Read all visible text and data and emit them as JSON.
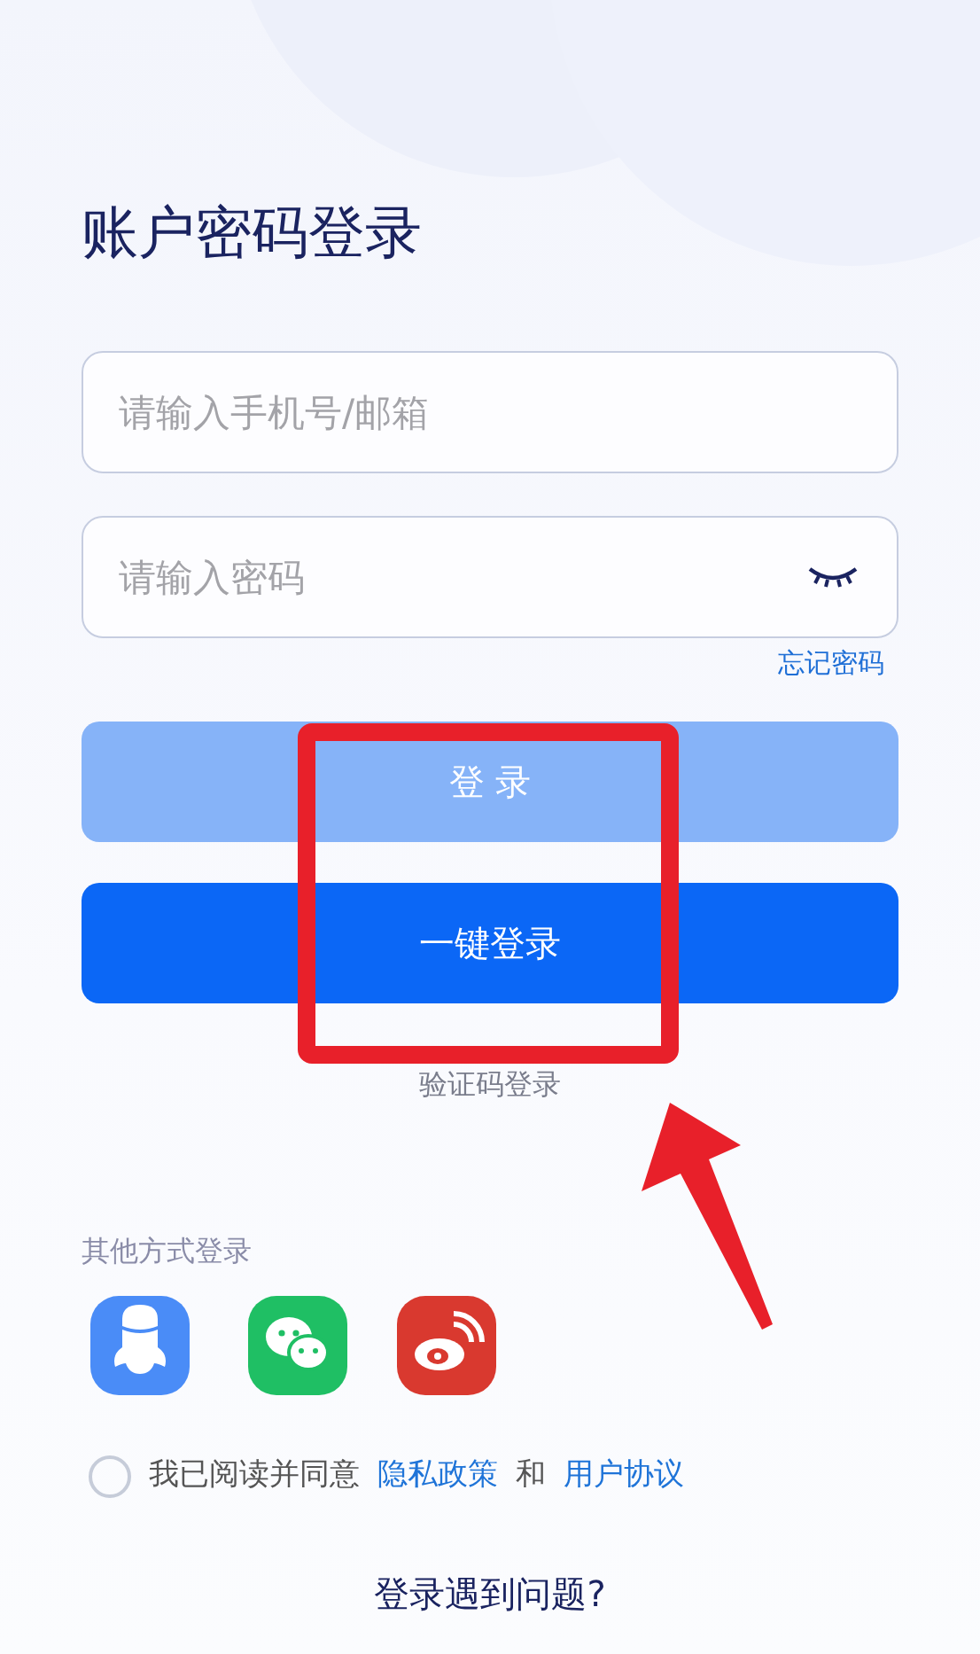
{
  "title": "账户密码登录",
  "fields": [
    {
      "kind": "text",
      "placeholder": "请输入手机号/邮箱"
    },
    {
      "kind": "password",
      "placeholder": "请输入密码",
      "revealed": false
    }
  ],
  "forgot_link": "忘记密码",
  "buttons": [
    {
      "label": "登 录",
      "disabled": true
    },
    {
      "label": "一键登录",
      "disabled": false
    }
  ],
  "alt_link": "验证码登录",
  "other_methods": {
    "label": "其他方式登录",
    "apps": [
      {
        "kind": "qq",
        "color": "#4a8cf7"
      },
      {
        "kind": "chat",
        "color": "#1fbf64"
      },
      {
        "kind": "weibo",
        "color": "#d9392f"
      }
    ]
  },
  "agreement": {
    "checked": false,
    "text": "我已阅读并同意",
    "link_1": "隐私政策",
    "joiner": "和",
    "link_2": "用户协议"
  },
  "help_link": "登录遇到问题?",
  "highlight_box": {
    "color": "#e8202a"
  },
  "arrow": {
    "color": "#e8202a"
  }
}
